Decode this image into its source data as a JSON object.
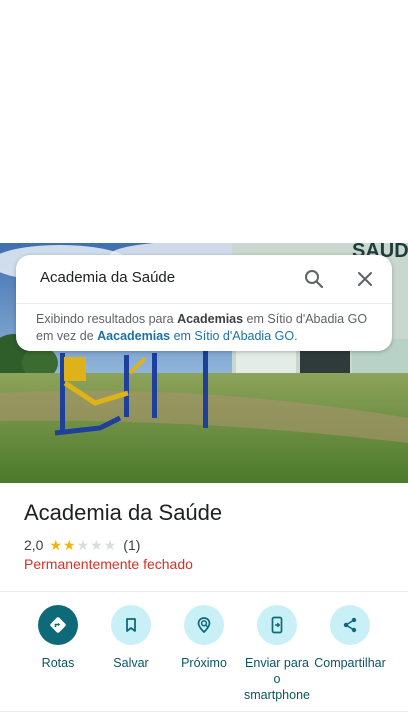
{
  "search": {
    "query": "Academia da Saúde",
    "notice": {
      "prefix": "Exibindo resultados para ",
      "shown_term": "Academias",
      "shown_location": " em Sítio d'Abadia GO",
      "instead_prefix": "em vez de ",
      "original_term": "Aacademias",
      "original_location": " em Sítio d'Abadia GO",
      "suffix": "."
    }
  },
  "place": {
    "name": "Academia da Saúde",
    "rating": "2,0",
    "rating_value": 2,
    "rating_max": 5,
    "review_count": "(1)",
    "status": "Permanentemente fechado"
  },
  "photo": {
    "sign_text": "SAÚDE"
  },
  "actions": [
    {
      "label": "Rotas",
      "icon": "directions-icon"
    },
    {
      "label": "Salvar",
      "icon": "bookmark-icon"
    },
    {
      "label": "Próximo",
      "icon": "nearby-icon"
    },
    {
      "label": "Enviar para o smartphone",
      "icon": "send-to-phone-icon"
    },
    {
      "label": "Compartilhar",
      "icon": "share-icon"
    }
  ],
  "colors": {
    "accent": "#0e6a79",
    "accent_light": "#c9f0f7",
    "closed_red": "#d93025",
    "star": "#f5b400",
    "link": "#1a73a8"
  }
}
